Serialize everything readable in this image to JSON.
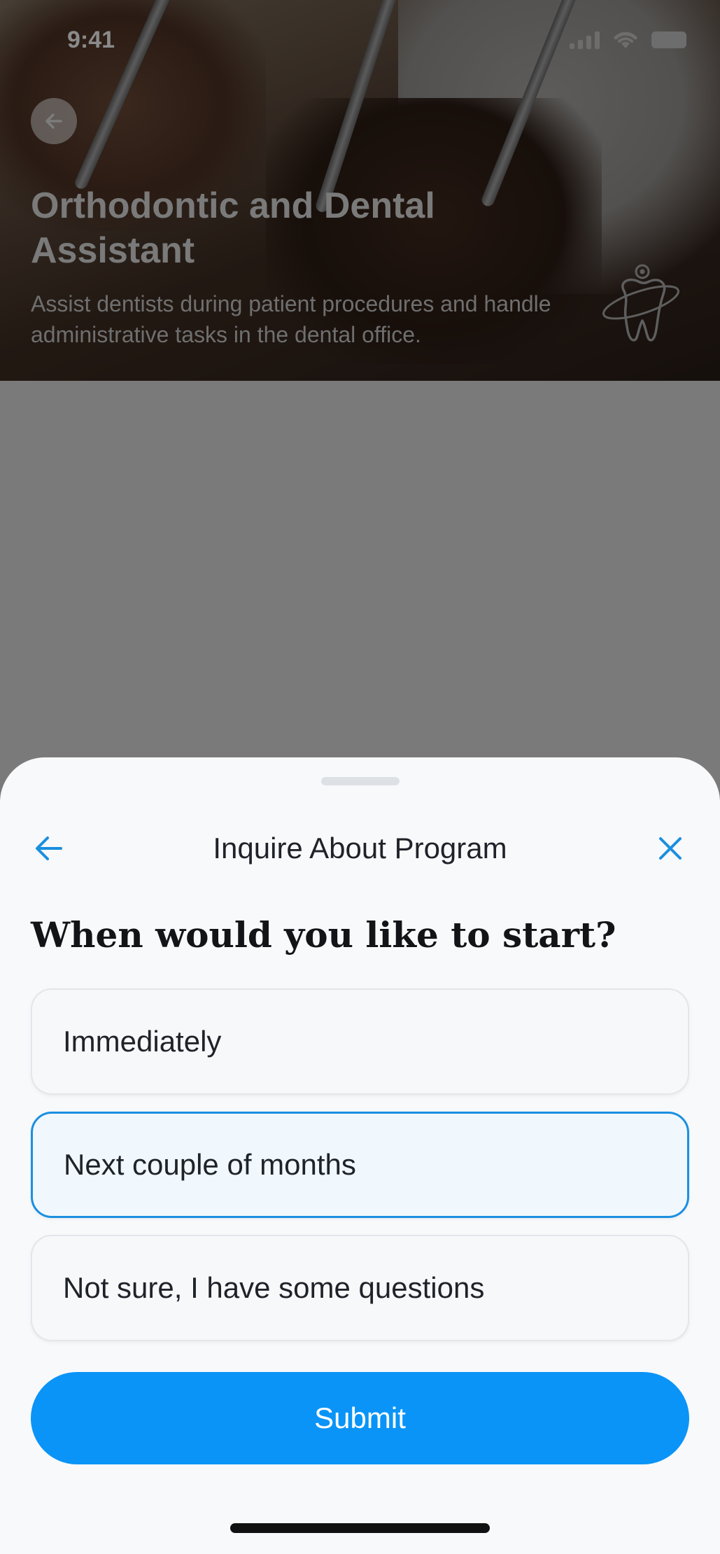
{
  "status_bar": {
    "time": "9:41"
  },
  "program": {
    "title": "Orthodontic and Dental Assistant",
    "description": "Assist dentists during patient procedures and handle administrative tasks in the dental office."
  },
  "sheet": {
    "title": "Inquire About Program",
    "question": "When would you like to start?",
    "options": [
      {
        "label": "Immediately",
        "selected": false
      },
      {
        "label": "Next couple of months",
        "selected": true
      },
      {
        "label": "Not sure, I have some questions",
        "selected": false
      }
    ],
    "submit_label": "Submit"
  },
  "colors": {
    "accent": "#0a94f7",
    "selected_border": "#1a8fe0",
    "sheet_background": "#f8f9fb",
    "dim_overlay": "#7a7a7a"
  },
  "icons": {
    "hero_back": "arrow-left-icon",
    "sheet_back": "arrow-left-icon",
    "sheet_close": "close-icon",
    "program": "tooth-icon"
  }
}
